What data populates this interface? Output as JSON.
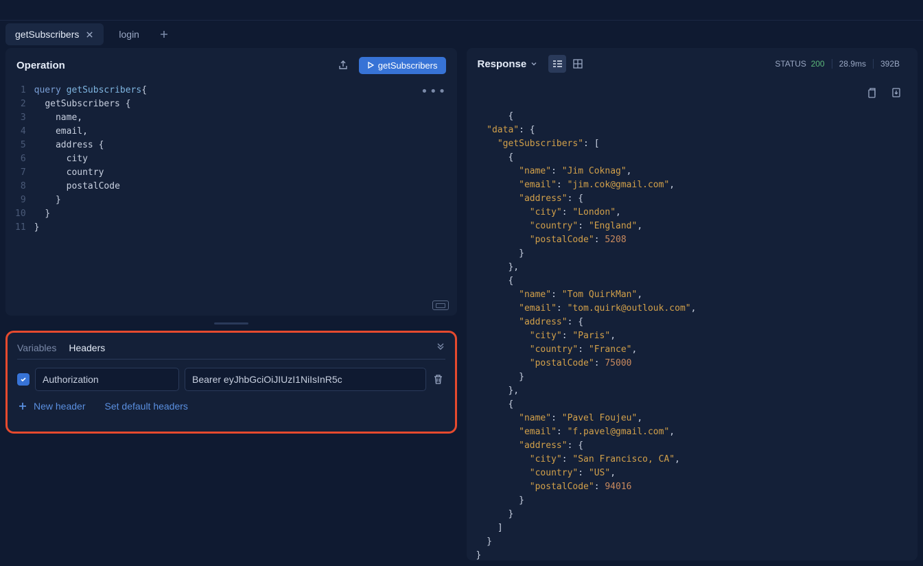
{
  "tabs": [
    {
      "label": "getSubscribers",
      "active": true
    },
    {
      "label": "login",
      "active": false
    }
  ],
  "operation": {
    "title": "Operation",
    "run_label": "getSubscribers",
    "code_lines": [
      {
        "n": "1",
        "html": "<span class=\"kw\">query</span> <span class=\"fn\">getSubscribers</span><span class=\"brace\">{</span>"
      },
      {
        "n": "2",
        "html": "  <span class=\"field\">getSubscribers</span> <span class=\"brace\">{</span>"
      },
      {
        "n": "3",
        "html": "    <span class=\"field\">name</span>,"
      },
      {
        "n": "4",
        "html": "    <span class=\"field\">email</span>,"
      },
      {
        "n": "5",
        "html": "    <span class=\"field\">address</span> <span class=\"brace\">{</span>"
      },
      {
        "n": "6",
        "html": "      <span class=\"field\">city</span>"
      },
      {
        "n": "7",
        "html": "      <span class=\"field\">country</span>"
      },
      {
        "n": "8",
        "html": "      <span class=\"field\">postalCode</span>"
      },
      {
        "n": "9",
        "html": "    <span class=\"brace\">}</span>"
      },
      {
        "n": "10",
        "html": "  <span class=\"brace\">}</span>"
      },
      {
        "n": "11",
        "html": "<span class=\"brace\">}</span>"
      }
    ]
  },
  "bottom": {
    "tab_variables": "Variables",
    "tab_headers": "Headers",
    "header_key": "Authorization",
    "header_value": "Bearer eyJhbGciOiJIUzI1NiIsInR5c",
    "new_header": "New header",
    "set_defaults": "Set default headers"
  },
  "response": {
    "title": "Response",
    "status_label": "STATUS",
    "status_code": "200",
    "time": "28.9ms",
    "size": "392B",
    "data": {
      "getSubscribers": [
        {
          "name": "Jim Coknag",
          "email": "jim.cok@gmail.com",
          "address": {
            "city": "London",
            "country": "England",
            "postalCode": 5208
          }
        },
        {
          "name": "Tom QuirkMan",
          "email": "tom.quirk@outlouk.com",
          "address": {
            "city": "Paris",
            "country": "France",
            "postalCode": 75000
          }
        },
        {
          "name": "Pavel Foujeu",
          "email": "f.pavel@gmail.com",
          "address": {
            "city": "San Francisco, CA",
            "country": "US",
            "postalCode": 94016
          }
        }
      ]
    }
  }
}
